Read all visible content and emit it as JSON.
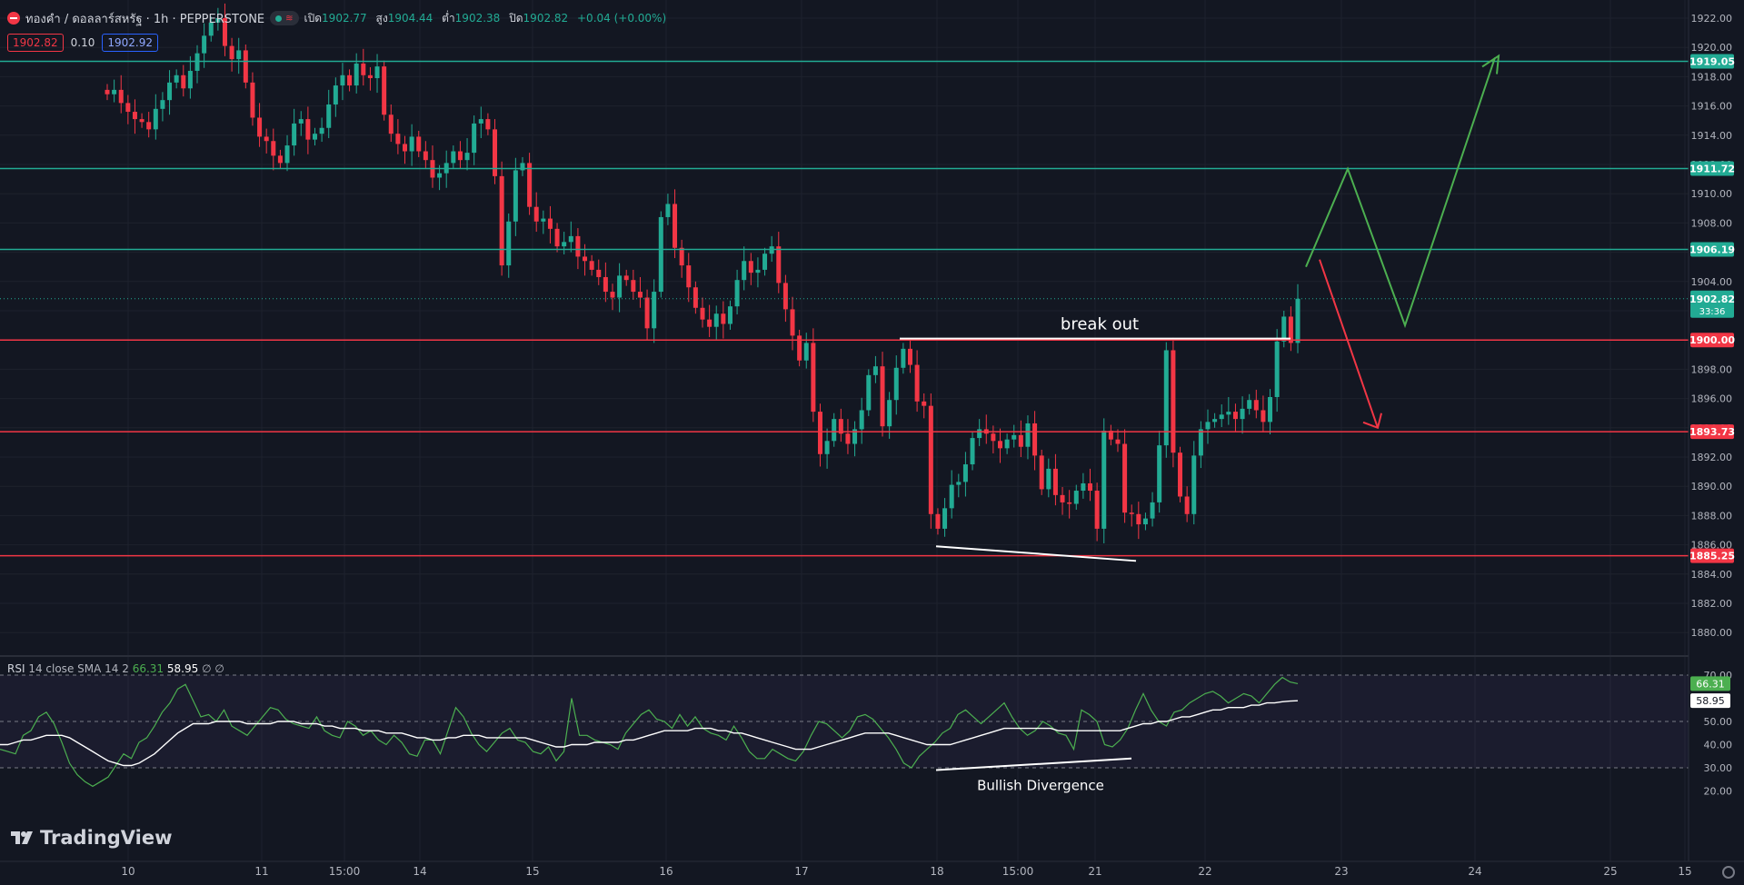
{
  "header": {
    "symbol_title": "ทองคำ / ดอลลาร์สหรัฐ · 1h · PEPPERSTONE",
    "open_label": "เปิด",
    "open": "1902.77",
    "high_label": "สูง",
    "high": "1904.44",
    "low_label": "ต่ำ",
    "low": "1902.38",
    "close_label": "ปิด",
    "close": "1902.82",
    "change": "+0.04 (+0.00%)",
    "sell_price": "1902.82",
    "spread": "0.10",
    "buy_price": "1902.92"
  },
  "rsi_legend": {
    "name": "RSI",
    "params": "14 close SMA 14 2",
    "rsi_value": "66.31",
    "ma_value": "58.95",
    "extra": "∅ ∅"
  },
  "logo": {
    "text": "TradingView",
    "icon": "tradingview-logo-icon"
  },
  "colors": {
    "background": "#131722",
    "up": "#22ab94",
    "down": "#f23645",
    "resistance_line": "#22ab94",
    "support_line": "#f23645",
    "projection_up": "#4caf50",
    "projection_down": "#f23645",
    "rsi_line": "#4caf50",
    "rsi_ma": "#ffffff"
  },
  "chart_data": [
    {
      "type": "candlestick",
      "title": "ทองคำ / ดอลลาร์สหรัฐ · 1h · PEPPERSTONE",
      "ylim": [
        1878.5,
        1922.5
      ],
      "y_ticks": [
        "1922.00",
        "1920.00",
        "1918.00",
        "1916.00",
        "1914.00",
        "1912.00",
        "1910.00",
        "1908.00",
        "1906.00",
        "1904.00",
        "1902.00",
        "1900.00",
        "1898.00",
        "1896.00",
        "1894.00",
        "1892.00",
        "1890.00",
        "1888.00",
        "1886.00",
        "1884.00",
        "1882.00",
        "1880.00"
      ],
      "x_ticks": [
        "10",
        "11",
        "15:00",
        "14",
        "15",
        "16",
        "17",
        "18",
        "15:00",
        "21",
        "22",
        "23",
        "24",
        "25",
        "15"
      ],
      "close_series": [
        1916.8,
        1917.1,
        1916.2,
        1915.6,
        1915.1,
        1914.9,
        1914.4,
        1915.8,
        1916.4,
        1917.6,
        1918.1,
        1917.2,
        1918.4,
        1919.6,
        1920.8,
        1921.7,
        1922.0,
        1920.1,
        1919.2,
        1919.8,
        1917.6,
        1915.2,
        1913.9,
        1913.6,
        1912.6,
        1912.1,
        1913.3,
        1914.8,
        1915.1,
        1913.7,
        1914.1,
        1914.5,
        1916.1,
        1917.4,
        1918.1,
        1917.4,
        1918.9,
        1918.1,
        1917.9,
        1918.7,
        1915.4,
        1914.1,
        1913.4,
        1912.9,
        1913.9,
        1912.9,
        1912.3,
        1911.1,
        1911.4,
        1912.1,
        1912.9,
        1912.3,
        1912.8,
        1914.8,
        1915.1,
        1914.4,
        1911.2,
        1905.1,
        1908.1,
        1911.6,
        1912.1,
        1909.1,
        1908.1,
        1908.3,
        1907.6,
        1906.4,
        1906.7,
        1907.1,
        1905.7,
        1905.4,
        1904.8,
        1904.3,
        1903.3,
        1902.9,
        1904.4,
        1904.1,
        1903.3,
        1902.9,
        1900.8,
        1903.3,
        1908.4,
        1909.3,
        1906.3,
        1905.1,
        1903.6,
        1902.2,
        1901.4,
        1900.9,
        1901.8,
        1901.1,
        1902.3,
        1904.1,
        1905.4,
        1904.6,
        1904.8,
        1905.9,
        1906.4,
        1903.9,
        1902.1,
        1900.3,
        1898.6,
        1899.8,
        1895.1,
        1892.2,
        1893.1,
        1894.6,
        1893.6,
        1892.9,
        1893.9,
        1895.2,
        1897.6,
        1898.2,
        1894.1,
        1895.9,
        1898.1,
        1899.4,
        1898.3,
        1895.8,
        1895.5,
        1888.1,
        1887.1,
        1888.5,
        1890.1,
        1890.3,
        1891.5,
        1893.3,
        1893.9,
        1893.6,
        1893.1,
        1892.6,
        1893.2,
        1893.5,
        1892.7,
        1894.3,
        1892.1,
        1889.8,
        1891.2,
        1889.4,
        1888.9,
        1888.8,
        1889.7,
        1890.2,
        1889.7,
        1887.1,
        1893.8,
        1893.2,
        1892.9,
        1888.2,
        1888.1,
        1887.4,
        1887.8,
        1888.9,
        1892.8,
        1899.3,
        1892.3,
        1889.3,
        1888.1,
        1892.1,
        1893.9,
        1894.4,
        1894.6,
        1894.9,
        1895.1,
        1894.6,
        1895.3,
        1895.9,
        1895.2,
        1894.4,
        1896.1,
        1899.9,
        1901.6,
        1899.8,
        1902.82
      ],
      "horizontal_levels": [
        {
          "value": 1919.05,
          "label": "1919.05",
          "color": "#22ab94"
        },
        {
          "value": 1911.72,
          "label": "1911.72",
          "color": "#22ab94"
        },
        {
          "value": 1906.19,
          "label": "1906.19",
          "color": "#22ab94"
        },
        {
          "value": 1900.0,
          "label": "1900.00",
          "color": "#f23645"
        },
        {
          "value": 1893.73,
          "label": "1893.73",
          "color": "#f23645"
        },
        {
          "value": 1885.25,
          "label": "1885.25",
          "color": "#f23645"
        }
      ],
      "current_price": {
        "value": 1902.82,
        "label": "1902.82",
        "countdown": "33:36"
      },
      "annotations": [
        {
          "text": "break out",
          "kind": "breakout-line",
          "value": 1900.1
        },
        {
          "text": "",
          "kind": "support-trend",
          "from_value": 1885.9,
          "to_value": 1884.9
        },
        {
          "text": "",
          "kind": "projection-up",
          "path": [
            1905.0,
            1911.7,
            1901.0,
            1919.3
          ]
        },
        {
          "text": "",
          "kind": "projection-down",
          "path": [
            1905.5,
            1894.0
          ]
        }
      ]
    },
    {
      "type": "line",
      "title": "RSI 14 close SMA 14 2",
      "ylim": [
        18,
        72
      ],
      "y_ticks": [
        "70.00",
        "50.00",
        "40.00",
        "30.00",
        "20.00"
      ],
      "bands": [
        70,
        50,
        30
      ],
      "series": [
        {
          "name": "RSI",
          "values": [
            38,
            37,
            36,
            44,
            46,
            52,
            54,
            49,
            41,
            32,
            27,
            24,
            22,
            24,
            26,
            31,
            36,
            34,
            41,
            43,
            48,
            54,
            58,
            64,
            66,
            59,
            52,
            53,
            50,
            55,
            48,
            46,
            44,
            48,
            52,
            56,
            55,
            51,
            49,
            48,
            47,
            52,
            46,
            44,
            43,
            50,
            48,
            44,
            46,
            42,
            40,
            44,
            41,
            36,
            35,
            42,
            42,
            36,
            46,
            56,
            52,
            45,
            40,
            37,
            41,
            45,
            47,
            42,
            41,
            37,
            36,
            39,
            33,
            37,
            60,
            44,
            44,
            42,
            41,
            40,
            38,
            45,
            49,
            53,
            55,
            51,
            50,
            47,
            53,
            48,
            52,
            47,
            45,
            44,
            42,
            48,
            43,
            37,
            34,
            34,
            38,
            36,
            34,
            33,
            37,
            44,
            50,
            49,
            46,
            43,
            46,
            52,
            53,
            51,
            47,
            43,
            38,
            32,
            30,
            35,
            38,
            41,
            45,
            47,
            53,
            55,
            52,
            49,
            52,
            55,
            58,
            52,
            47,
            44,
            46,
            50,
            48,
            45,
            44,
            38,
            55,
            53,
            50,
            40,
            39,
            42,
            47,
            55,
            62,
            55,
            50,
            48,
            54,
            55,
            58,
            60,
            62,
            63,
            61,
            58,
            60,
            62,
            61,
            58,
            62,
            66,
            69,
            67,
            66.31
          ]
        },
        {
          "name": "RSI-based MA",
          "values": [
            40,
            40,
            41,
            42,
            42,
            43,
            44,
            44,
            44,
            43,
            41,
            39,
            37,
            35,
            33,
            32,
            31,
            31,
            32,
            34,
            36,
            39,
            42,
            45,
            47,
            49,
            49,
            49,
            50,
            50,
            50,
            50,
            49,
            49,
            49,
            49,
            50,
            50,
            50,
            49,
            49,
            49,
            48,
            48,
            47,
            47,
            47,
            46,
            46,
            46,
            45,
            45,
            45,
            44,
            43,
            43,
            42,
            42,
            43,
            43,
            44,
            44,
            44,
            43,
            43,
            43,
            43,
            43,
            43,
            42,
            41,
            40,
            39,
            39,
            40,
            40,
            40,
            41,
            41,
            41,
            41,
            42,
            42,
            43,
            44,
            45,
            46,
            46,
            46,
            46,
            47,
            47,
            47,
            46,
            46,
            45,
            45,
            44,
            43,
            42,
            41,
            40,
            39,
            38,
            38,
            38,
            39,
            40,
            41,
            42,
            43,
            44,
            45,
            45,
            45,
            45,
            44,
            43,
            42,
            41,
            40,
            40,
            40,
            40,
            41,
            42,
            43,
            44,
            45,
            46,
            47,
            47,
            47,
            47,
            47,
            47,
            47,
            46,
            46,
            46,
            46,
            46,
            46,
            46,
            46,
            46,
            47,
            48,
            49,
            49,
            50,
            50,
            51,
            52,
            52,
            53,
            54,
            55,
            55,
            56,
            56,
            56,
            57,
            57,
            58,
            58,
            58.5,
            58.8,
            58.95
          ]
        }
      ],
      "annotations": [
        {
          "text": "Bullish Divergence",
          "kind": "divergence-line",
          "from_value": 29,
          "to_value": 34
        }
      ]
    }
  ]
}
